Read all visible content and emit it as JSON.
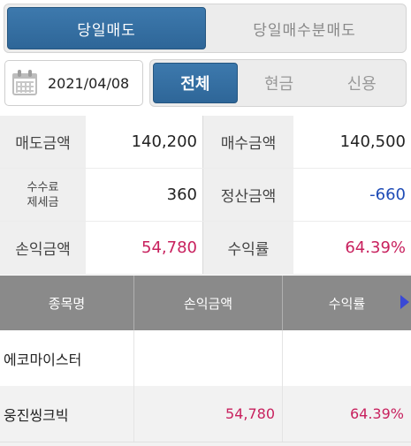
{
  "top_tabs": [
    {
      "label": "당일매도",
      "active": true
    },
    {
      "label": "당일매수분매도",
      "active": false
    }
  ],
  "date": "2021/04/08",
  "filter_tabs": [
    {
      "label": "전체",
      "active": true
    },
    {
      "label": "현금",
      "active": false
    },
    {
      "label": "신용",
      "active": false
    }
  ],
  "summary": {
    "sell_amount_label": "매도금액",
    "sell_amount": "140,200",
    "buy_amount_label": "매수금액",
    "buy_amount": "140,500",
    "fee_label_1": "수수료",
    "fee_label_2": "제세금",
    "fee_value": "360",
    "settle_label": "정산금액",
    "settle_value": "-660",
    "pnl_label": "손익금액",
    "pnl_value": "54,780",
    "return_label": "수익률",
    "return_value": "64.39%"
  },
  "list": {
    "headers": [
      "종목명",
      "손익금액",
      "수익률"
    ],
    "rows": [
      {
        "name": "에코마이스터",
        "pnl": "",
        "rate": ""
      },
      {
        "name": "웅진씽크빅",
        "pnl": "54,780",
        "rate": "64.39%"
      }
    ]
  },
  "colors": {
    "accent": "#2e6698",
    "positive": "#c8215e",
    "negative": "#1e4bb6"
  }
}
